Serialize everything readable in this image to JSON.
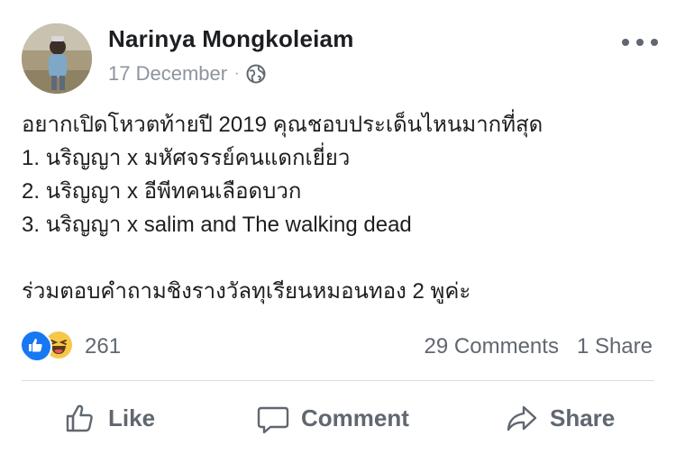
{
  "post": {
    "author": "Narinya Mongkoleiam",
    "date": "17 December",
    "separator": "·",
    "privacy_icon": "globe-icon",
    "more_icon": "more-options-icon",
    "body_lines": [
      "อยากเปิดโหวตท้ายปี 2019 คุณชอบประเด็นไหนมากที่สุด",
      "1. นริญญา x มหัศจรรย์คนแดกเยี่ยว",
      "2. นริญญา x อีพีทคนเลือดบวก",
      "3. นริญญา x salim and The walking dead",
      "",
      "ร่วมตอบคำถามชิงรางวัลทุเรียนหมอนทอง 2 พูค่ะ"
    ]
  },
  "reactions": {
    "types": [
      "like",
      "haha"
    ],
    "count": "261",
    "comments": "29 Comments",
    "shares": "1 Share"
  },
  "actions": {
    "like": "Like",
    "comment": "Comment",
    "share": "Share"
  },
  "colors": {
    "author_text": "#1c1e21",
    "meta_text": "#8d949e",
    "action_text": "#606770",
    "like_blue": "#1877f2",
    "haha_yellow": "#f7c74a",
    "divider": "#dadde1"
  }
}
